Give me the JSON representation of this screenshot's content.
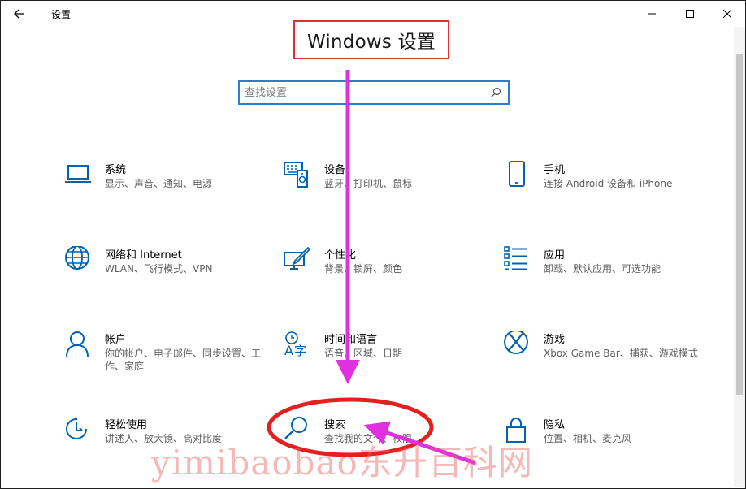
{
  "window": {
    "title": "设置"
  },
  "heading": "Windows 设置",
  "search": {
    "placeholder": "查找设置"
  },
  "tiles": [
    {
      "name": "系统",
      "desc": "显示、声音、通知、电源",
      "icon": "laptop-icon"
    },
    {
      "name": "设备",
      "desc": "蓝牙、打印机、鼠标",
      "icon": "devices-icon"
    },
    {
      "name": "手机",
      "desc": "连接 Android 设备和 iPhone",
      "icon": "phone-icon"
    },
    {
      "name": "网络和 Internet",
      "desc": "WLAN、飞行模式、VPN",
      "icon": "globe-icon"
    },
    {
      "name": "个性化",
      "desc": "背景、锁屏、颜色",
      "icon": "personalization-icon"
    },
    {
      "name": "应用",
      "desc": "卸载、默认应用、可选功能",
      "icon": "apps-list-icon"
    },
    {
      "name": "帐户",
      "desc": "你的帐户、电子邮件、同步设置、工作、家庭",
      "icon": "person-icon"
    },
    {
      "name": "时间和语言",
      "desc": "语音、区域、日期",
      "icon": "time-language-icon"
    },
    {
      "name": "游戏",
      "desc": "Xbox Game Bar、捕获、游戏模式",
      "icon": "xbox-icon"
    },
    {
      "name": "轻松使用",
      "desc": "讲述人、放大镜、高对比度",
      "icon": "ease-of-access-icon"
    },
    {
      "name": "搜索",
      "desc": "查找我的文件、权限",
      "icon": "search-magnifier-icon"
    },
    {
      "name": "隐私",
      "desc": "位置、相机、麦克风",
      "icon": "lock-icon"
    }
  ],
  "watermark": "yimibaobao东升百科网",
  "colors": {
    "accent": "#0063b1",
    "highlight_border": "#e0302e",
    "annotation": "#e030e0",
    "search_border": "#2b7cd3"
  }
}
